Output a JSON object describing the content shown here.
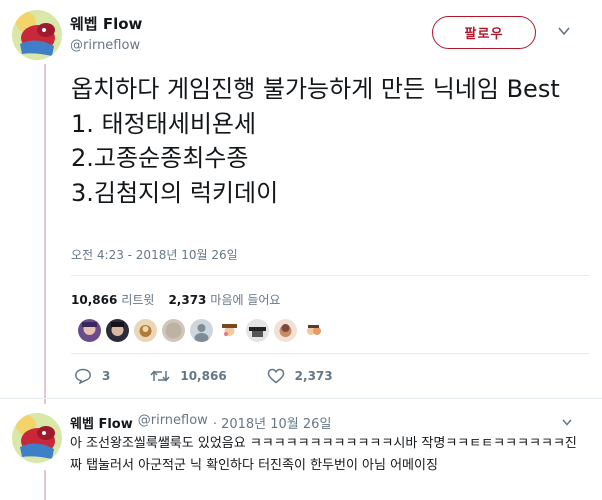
{
  "tweet": {
    "display_name": "웨벱 Flow",
    "handle": "@rirneflow",
    "follow_label": "팔로우",
    "text": "옵치하다 게임진행 불가능하게 만든 닉네임 Best\n1. 태정태세비욘세\n2.고종순종최수종\n3.김첨지의 럭키데이",
    "timestamp": "오전 4:23 - 2018년 10월 26일",
    "retweet_count": "10,866",
    "retweet_label": "리트윗",
    "like_count": "2,373",
    "like_label": "마음에 들어요",
    "actions": {
      "reply_count": "3",
      "retweet_count": "10,866",
      "like_count": "2,373"
    }
  },
  "reply": {
    "display_name": "웨벱 Flow",
    "handle": "@rirneflow",
    "date": "· 2018년 10월 26일",
    "text": "아 조선왕조씰룩쌜룩도 있었음요 ㅋㅋㅋㅋㅋㅋㅋㅋㅋㅋㅋㅋ시바 작명ㅋㅋㅌㅌㅋㅋㅋㅋㅋㅋ진짜 탭눌러서 아군적군 닉 확인하다 터진족이 한두번이 아님 어메이징"
  },
  "colors": {
    "accent": "#b0172a",
    "muted": "#657786",
    "thread": "#e6c5cd"
  },
  "icons": [
    "chevron-down-icon",
    "reply-icon",
    "retweet-icon",
    "heart-icon",
    "avatar-icon"
  ]
}
